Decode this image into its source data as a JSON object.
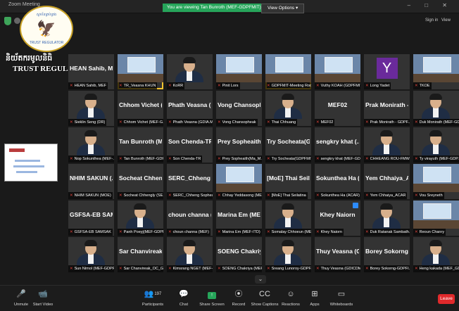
{
  "window": {
    "title": "Zoom Meeting",
    "controls": "– □ ✕"
  },
  "banner": {
    "text": "You are viewing Tan Bunroth (MEF-GDPFMIT)'s screen",
    "view_options": "View Options ▾"
  },
  "top_right": {
    "signin": "Sign in",
    "view": "View"
  },
  "logo": {
    "top_text": "ស្ថាប័នគ្រប់គ្រង",
    "bottom_text": "TRUST REGULATOR",
    "khmer": "និយ័តករមូលនិធិ",
    "english": "TRUST REGULATOR"
  },
  "participants": [
    {
      "big": "HEAN Sahib, MEF",
      "label": "HEAN Sahib, MEF",
      "type": "name"
    },
    {
      "big": "",
      "label": "TR_Veasna KHUN",
      "type": "room",
      "active": true
    },
    {
      "big": "",
      "label": "KoRR",
      "type": "person"
    },
    {
      "big": "",
      "label": "Pinit Lors",
      "type": "room"
    },
    {
      "big": "",
      "label": "GDPFMIT-Meeting Room",
      "type": "room",
      "active": true
    },
    {
      "big": "",
      "label": "Vuthy KOAH (GDPFMIT)",
      "type": "room"
    },
    {
      "big": "",
      "label": "Long Yadet",
      "type": "letter",
      "letter": "Y"
    },
    {
      "big": "",
      "label": "TKOE",
      "type": "room"
    },
    {
      "big": "",
      "label": "Sieklin Seng (DR)",
      "type": "person"
    },
    {
      "big": "Chhom Vichet (...",
      "label": "Chhom Vichet (MEF-G...",
      "type": "name"
    },
    {
      "big": "Phath Veasna (...",
      "label": "Phath Veasna (GDIA.M...",
      "type": "name"
    },
    {
      "big": "Vong Chansoph...",
      "label": "Vong Chansopheak",
      "type": "name"
    },
    {
      "big": "",
      "label": "Thai Chhuang",
      "type": "person"
    },
    {
      "big": "MEF02",
      "label": "MEF02",
      "type": "name"
    },
    {
      "big": "Prak Monirath -...",
      "label": "Prak Monirath - GDPF...",
      "type": "name"
    },
    {
      "big": "",
      "label": "Duk Monirath (MEF-GDP...",
      "type": "person"
    },
    {
      "big": "",
      "label": "Nop Sokunthea (MEF-...",
      "type": "person"
    },
    {
      "big": "Tan Bunroth (M...",
      "label": "Tan Bunroth (MEF-GDPF...",
      "type": "name"
    },
    {
      "big": "Son Chenda-TR",
      "label": "Son Chenda-TR",
      "type": "name"
    },
    {
      "big": "Prey Sopheaith...",
      "label": "Prey Sopheaith(Ma_M...",
      "type": "name"
    },
    {
      "big": "Try Socheata(G...",
      "label": "Try Socheata(GDPFMIT)",
      "type": "name"
    },
    {
      "big": "sengkry khat (...",
      "label": "sengkry khat (MEF-GD...",
      "type": "name"
    },
    {
      "big": "",
      "label": "CHHEANG ROU-FMW...",
      "type": "person"
    },
    {
      "big": "",
      "label": "Ty virayuth (MEF-GDP...",
      "type": "person"
    },
    {
      "big": "NHIM SAKUN (...",
      "label": "NHIM SAKUN (MOE)",
      "type": "name"
    },
    {
      "big": "Socheat Chheng...",
      "label": "Socheat Chhengly (SE...",
      "type": "name"
    },
    {
      "big": "SERC_Chheng S...",
      "label": "SERC_Chheng Sophea...",
      "type": "name"
    },
    {
      "big": "",
      "label": "Chhay Yeddasong (MEF...",
      "type": "room"
    },
    {
      "big": "[MoE] Thai Seila...",
      "label": "[MoE] Thai Seilatina",
      "type": "name"
    },
    {
      "big": "Sokunthea Ha (...",
      "label": "Sokunthea Ha (ACAR)",
      "type": "name"
    },
    {
      "big": "Yem Chhaiya_A...",
      "label": "Yem Chhaiya_ACAR",
      "type": "name"
    },
    {
      "big": "",
      "label": "Vou Sreyneth",
      "type": "room"
    },
    {
      "big": "GSFSA-EB SAM...",
      "label": "GSFSA-EB SAMSAK",
      "type": "name"
    },
    {
      "big": "",
      "label": "Panh Poeyj(MEF-GDPF...",
      "type": "person"
    },
    {
      "big": "choun channa (...",
      "label": "choun channa (MEF)",
      "type": "name"
    },
    {
      "big": "Marina Em (ME...",
      "label": "Marina Em (MEF-ITD)",
      "type": "name"
    },
    {
      "big": "",
      "label": "Somalay Chhoeun (MEF...",
      "type": "person"
    },
    {
      "big": "Khey Naiorn",
      "label": "Khey Naiorn",
      "type": "name",
      "pin": true
    },
    {
      "big": "",
      "label": "Duk Ratanak Sambath...",
      "type": "person"
    },
    {
      "big": "",
      "label": "Reoun Chanry",
      "type": "room"
    },
    {
      "big": "",
      "label": "Sun Nimol (MEF-GDPF...",
      "type": "person"
    },
    {
      "big": "Sar Chanvireak_...",
      "label": "Sar Chanvireak_OC_G...",
      "type": "name"
    },
    {
      "big": "",
      "label": "Kimsrang NGET (MEF-...",
      "type": "person"
    },
    {
      "big": "SOENG Chakriy...",
      "label": "SOENG Chakriya (MEF...",
      "type": "name"
    },
    {
      "big": "",
      "label": "Sreang Lunoroy-GDPF...",
      "type": "person"
    },
    {
      "big": "Thuy Veasna (G...",
      "label": "Thuy Veasna (GDICDM)",
      "type": "name"
    },
    {
      "big": "Borey Sokorng-...",
      "label": "Borey Sokorng-GDPFI...",
      "type": "name"
    },
    {
      "big": "",
      "label": "Heng kakada (MEF_GD...",
      "type": "person"
    }
  ],
  "toolbar": [
    {
      "id": "unmute",
      "icon": "🎤",
      "label": "Unmute"
    },
    {
      "id": "start-video",
      "icon": "📹",
      "label": "Start Video"
    },
    {
      "id": "participants",
      "icon": "👥",
      "label": "Participants",
      "count": "197"
    },
    {
      "id": "chat",
      "icon": "💬",
      "label": "Chat"
    },
    {
      "id": "share-screen",
      "icon": "↑",
      "label": "Share Screen"
    },
    {
      "id": "record",
      "icon": "⦿",
      "label": "Record"
    },
    {
      "id": "show-captions",
      "icon": "CC",
      "label": "Show Captions"
    },
    {
      "id": "reactions",
      "icon": "☺",
      "label": "Reactions"
    },
    {
      "id": "apps",
      "icon": "⊞",
      "label": "Apps"
    },
    {
      "id": "whiteboards",
      "icon": "▭",
      "label": "Whiteboards"
    }
  ],
  "end_label": "Leave"
}
